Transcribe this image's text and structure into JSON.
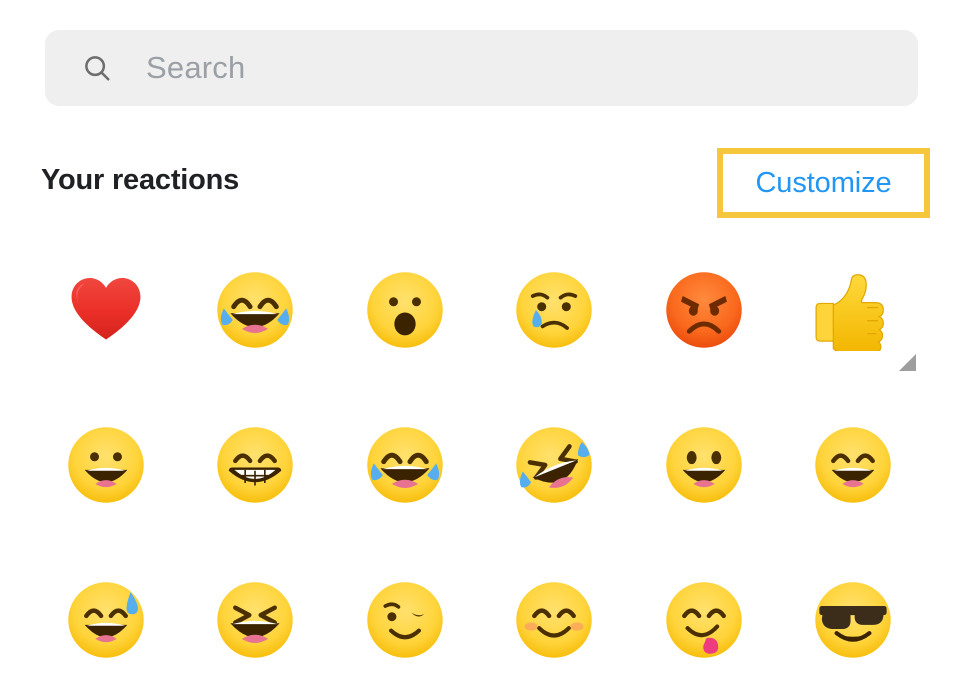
{
  "search": {
    "icon": "search-icon",
    "placeholder": "Search",
    "value": ""
  },
  "section": {
    "title": "Your reactions",
    "customize_label": "Customize",
    "highlight_color": "#f6c63c",
    "link_color": "#2196f3"
  },
  "emoji_grid": {
    "columns": 6,
    "variant_marker_color": "#9e9e9e",
    "items": [
      {
        "name": "red-heart",
        "char": "❤️",
        "has_variant_marker": false
      },
      {
        "name": "face-with-tears-of-joy",
        "char": "😂",
        "has_variant_marker": false
      },
      {
        "name": "face-with-open-mouth",
        "char": "😮",
        "has_variant_marker": false
      },
      {
        "name": "crying-face",
        "char": "😢",
        "has_variant_marker": false
      },
      {
        "name": "pouting-face",
        "char": "😡",
        "has_variant_marker": false
      },
      {
        "name": "thumbs-up",
        "char": "👍",
        "has_variant_marker": true
      },
      {
        "name": "grinning-face",
        "char": "😀",
        "has_variant_marker": false
      },
      {
        "name": "beaming-face-with-smiling-eyes",
        "char": "😁",
        "has_variant_marker": false
      },
      {
        "name": "face-with-tears-of-joy-2",
        "char": "😂",
        "has_variant_marker": false
      },
      {
        "name": "rolling-on-the-floor-laughing",
        "char": "🤣",
        "has_variant_marker": false
      },
      {
        "name": "grinning-face-with-big-eyes",
        "char": "😃",
        "has_variant_marker": false
      },
      {
        "name": "grinning-face-with-smiling-eyes",
        "char": "😄",
        "has_variant_marker": false
      },
      {
        "name": "grinning-face-with-sweat",
        "char": "😅",
        "has_variant_marker": false
      },
      {
        "name": "squinting-face-with-closed-eyes",
        "char": "😆",
        "has_variant_marker": false
      },
      {
        "name": "winking-face",
        "char": "😉",
        "has_variant_marker": false
      },
      {
        "name": "smiling-face-with-smiling-eyes",
        "char": "😊",
        "has_variant_marker": false
      },
      {
        "name": "face-savoring-food",
        "char": "😋",
        "has_variant_marker": false
      },
      {
        "name": "smiling-face-with-sunglasses",
        "char": "😎",
        "has_variant_marker": false
      }
    ]
  }
}
